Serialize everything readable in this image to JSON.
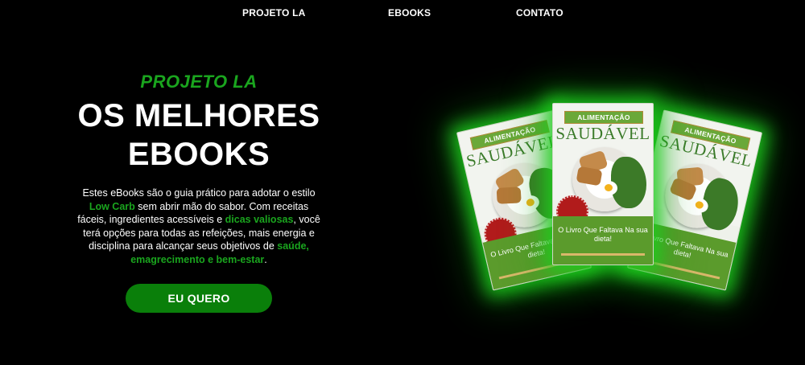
{
  "nav": {
    "items": [
      "PROJETO LA",
      "EBOOKS",
      "CONTATO"
    ]
  },
  "hero": {
    "eyebrow": "PROJETO LA",
    "headline_line1": "OS MELHORES",
    "headline_line2": "EBOOKS",
    "desc_p1": "Estes eBooks são o guia prático para adotar o estilo ",
    "desc_hl1": "Low Carb",
    "desc_p2": " sem abrir mão do sabor. Com receitas fáceis, ingredientes acessíveis e ",
    "desc_hl2": "dicas valiosas",
    "desc_p3": ", você terá opções para todas as refeições, mais energia e disciplina para alcançar seus objetivos de ",
    "desc_hl3": "saúde, emagrecimento e bem-estar",
    "desc_p4": ".",
    "cta_label": "EU QUERO"
  },
  "books": {
    "ribbon": "ALIMENTAÇÃO",
    "title": "SAUDÁVEL",
    "tagline": "O Livro Que Faltava Na sua dieta!"
  },
  "colors": {
    "accent_green": "#1aa51e",
    "button_green": "#0a7f0a",
    "background": "#000000"
  }
}
